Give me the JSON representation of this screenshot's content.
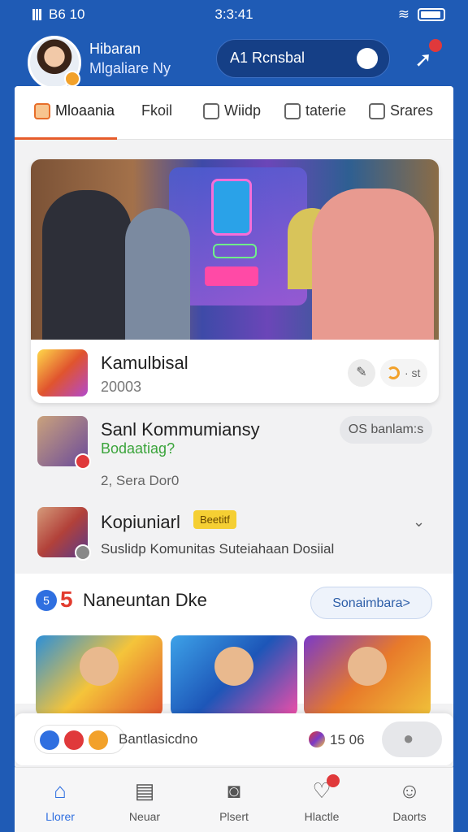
{
  "status": {
    "left_text": "B6 10",
    "time": "3:3:41"
  },
  "profile": {
    "name": "Hibaran",
    "subtitle": "Mlgaliare Ny"
  },
  "search": {
    "label": "A1 Rcnsbal"
  },
  "tabs": [
    {
      "label": "Mloaania",
      "icon": "home-icon"
    },
    {
      "label": "Fkoil",
      "icon": ""
    },
    {
      "label": "Wiidp",
      "icon": "diamond-icon"
    },
    {
      "label": "taterie",
      "icon": "pencil-icon"
    },
    {
      "label": "Srares",
      "icon": "share-icon"
    }
  ],
  "feature_card": {
    "title": "Kamulbisal",
    "subtitle": "20003",
    "action_label": "· st"
  },
  "list": [
    {
      "title": "Sanl Kommumiansy",
      "subtitle": "Bodaatiag?",
      "meta": "2, Sera Dor0",
      "pill": "OS banlam:s"
    },
    {
      "title": "Kopiuniarl",
      "tag": "Beetitf",
      "subtitle": "Suslidp Komunitas Suteiahaan Dosiial"
    }
  ],
  "section": {
    "number_icon": "5",
    "number": "5",
    "title": "Naneuntan Dke",
    "more_label": "Sonaimbara>"
  },
  "share_bar": {
    "text": "Bantlasicdno",
    "count": "15 06"
  },
  "bottom_nav": [
    {
      "label": "Llorer",
      "icon": "home-icon"
    },
    {
      "label": "Neuar",
      "icon": "news-icon"
    },
    {
      "label": "Plsert",
      "icon": "camera-icon"
    },
    {
      "label": "Hlactle",
      "icon": "heart-icon"
    },
    {
      "label": "Daorts",
      "icon": "person-icon"
    }
  ],
  "colors": {
    "brand": "#1f5bb5",
    "accent": "#e65c2a",
    "active": "#2f6fe0"
  }
}
